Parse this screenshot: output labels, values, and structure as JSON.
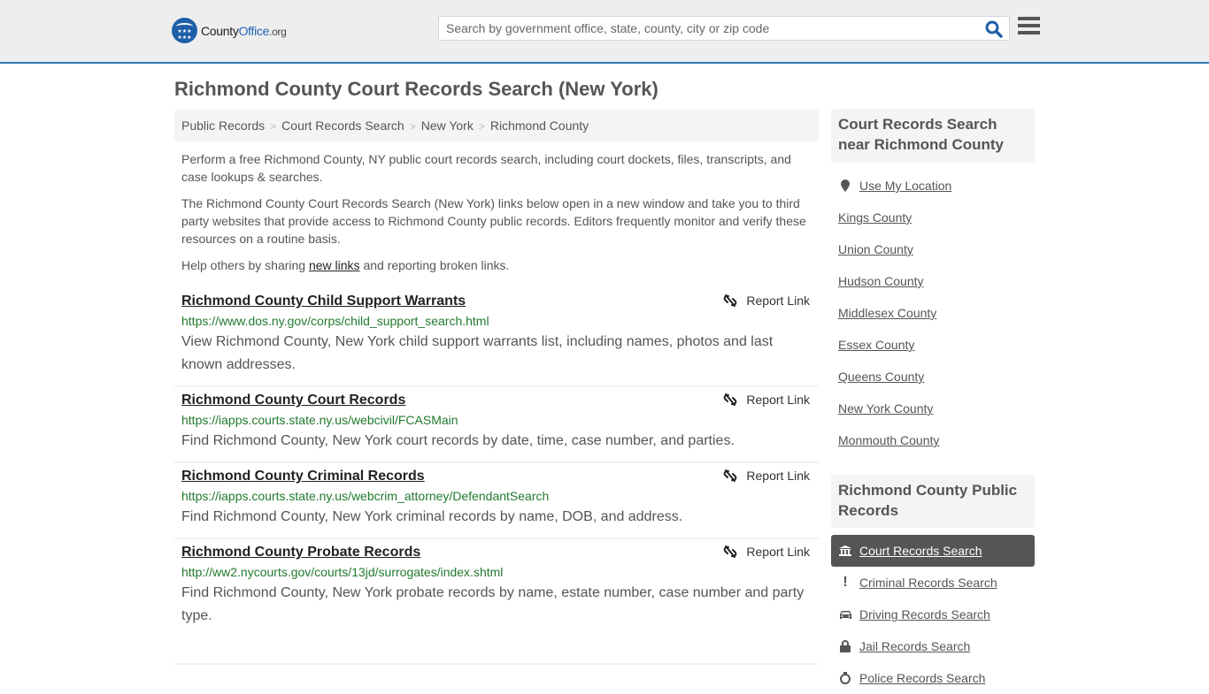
{
  "header": {
    "logo": {
      "part1": "County",
      "part2": "Office",
      "part3": ".org"
    },
    "search_placeholder": "Search by government office, state, county, city or zip code",
    "search_value": ""
  },
  "page_title": "Richmond County Court Records Search (New York)",
  "breadcrumb": [
    "Public Records",
    "Court Records Search",
    "New York",
    "Richmond County"
  ],
  "intro": {
    "p1": "Perform a free Richmond County, NY public court records search, including court dockets, files, transcripts, and case lookups & searches.",
    "p2": "The Richmond County Court Records Search (New York) links below open in a new window and take you to third party websites that provide access to Richmond County public records. Editors frequently monitor and verify these resources on a routine basis.",
    "p3_before": "Help others by sharing ",
    "p3_link": "new links",
    "p3_after": " and reporting broken links."
  },
  "report_label": "Report Link",
  "results": [
    {
      "title": "Richmond County Child Support Warrants",
      "url": "https://www.dos.ny.gov/corps/child_support_search.html",
      "desc": "View Richmond County, New York child support warrants list, including names, photos and last known addresses."
    },
    {
      "title": "Richmond County Court Records",
      "url": "https://iapps.courts.state.ny.us/webcivil/FCASMain",
      "desc": "Find Richmond County, New York court records by date, time, case number, and parties."
    },
    {
      "title": "Richmond County Criminal Records",
      "url": "https://iapps.courts.state.ny.us/webcrim_attorney/DefendantSearch",
      "desc": "Find Richmond County, New York criminal records by name, DOB, and address."
    },
    {
      "title": "Richmond County Probate Records",
      "url": "http://ww2.nycourts.gov/courts/13jd/surrogates/index.shtml",
      "desc": "Find Richmond County, New York probate records by name, estate number, case number and party type."
    }
  ],
  "sidebar": {
    "nearby": {
      "heading": "Court Records Search near Richmond County",
      "use_location": "Use My Location",
      "items": [
        "Kings County",
        "Union County",
        "Hudson County",
        "Middlesex County",
        "Essex County",
        "Queens County",
        "New York County",
        "Monmouth County"
      ]
    },
    "public_records": {
      "heading": "Richmond County Public Records",
      "items": [
        {
          "label": "Court Records Search",
          "icon": "courthouse-icon",
          "active": true
        },
        {
          "label": "Criminal Records Search",
          "icon": "exclamation-icon",
          "active": false
        },
        {
          "label": "Driving Records Search",
          "icon": "car-icon",
          "active": false
        },
        {
          "label": "Jail Records Search",
          "icon": "lock-icon",
          "active": false
        },
        {
          "label": "Police Records Search",
          "icon": "police-icon",
          "active": false
        }
      ]
    }
  },
  "colors": {
    "accent_border": "#2e78b5",
    "logo_blue": "#1f66b3",
    "url_green": "#217a2e",
    "active_item_bg": "#555555"
  }
}
